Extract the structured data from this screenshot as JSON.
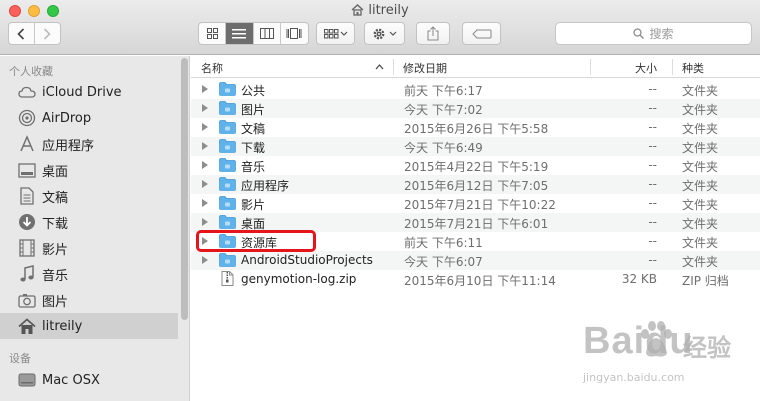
{
  "window": {
    "title": "litreily",
    "search_placeholder": "搜索"
  },
  "sidebar": {
    "favorites_label": "个人收藏",
    "devices_label": "设备",
    "favorites": [
      {
        "label": "iCloud Drive",
        "icon": "cloud-icon"
      },
      {
        "label": "AirDrop",
        "icon": "airdrop-icon"
      },
      {
        "label": "应用程序",
        "icon": "applications-icon"
      },
      {
        "label": "桌面",
        "icon": "desktop-icon"
      },
      {
        "label": "文稿",
        "icon": "documents-icon"
      },
      {
        "label": "下载",
        "icon": "downloads-icon"
      },
      {
        "label": "影片",
        "icon": "movies-icon"
      },
      {
        "label": "音乐",
        "icon": "music-icon"
      },
      {
        "label": "图片",
        "icon": "pictures-icon"
      },
      {
        "label": "litreily",
        "icon": "home-icon",
        "selected": true
      }
    ],
    "devices": [
      {
        "label": "Mac OSX",
        "icon": "disk-icon"
      }
    ]
  },
  "columns": {
    "name": "名称",
    "date": "修改日期",
    "size": "大小",
    "kind": "种类"
  },
  "files": [
    {
      "name": "公共",
      "date": "前天 下午6:17",
      "size": "--",
      "kind": "文件夹",
      "type": "folder"
    },
    {
      "name": "图片",
      "date": "今天 下午7:02",
      "size": "--",
      "kind": "文件夹",
      "type": "folder"
    },
    {
      "name": "文稿",
      "date": "2015年6月26日 下午5:58",
      "size": "--",
      "kind": "文件夹",
      "type": "folder"
    },
    {
      "name": "下载",
      "date": "今天 下午6:49",
      "size": "--",
      "kind": "文件夹",
      "type": "folder"
    },
    {
      "name": "音乐",
      "date": "2015年4月22日 下午5:19",
      "size": "--",
      "kind": "文件夹",
      "type": "folder"
    },
    {
      "name": "应用程序",
      "date": "2015年6月12日 下午7:05",
      "size": "--",
      "kind": "文件夹",
      "type": "folder"
    },
    {
      "name": "影片",
      "date": "2015年7月21日 下午10:22",
      "size": "--",
      "kind": "文件夹",
      "type": "folder"
    },
    {
      "name": "桌面",
      "date": "2015年7月21日 下午6:01",
      "size": "--",
      "kind": "文件夹",
      "type": "folder"
    },
    {
      "name": "资源库",
      "date": "前天 下午6:11",
      "size": "--",
      "kind": "文件夹",
      "type": "folder"
    },
    {
      "name": "AndroidStudioProjects",
      "date": "今天 下午6:07",
      "size": "--",
      "kind": "文件夹",
      "type": "folder"
    },
    {
      "name": "genymotion-log.zip",
      "date": "2015年6月10日 下午11:14",
      "size": "32 KB",
      "kind": "ZIP 归档",
      "type": "zip"
    }
  ],
  "watermark": {
    "brand": "Baidu",
    "cn": "经验",
    "url": "jingyan.baidu.com"
  },
  "colors": {
    "folder": "#5fb3ea",
    "highlight": "#e6151c",
    "selected_sidebar": "#d0d0d0"
  }
}
